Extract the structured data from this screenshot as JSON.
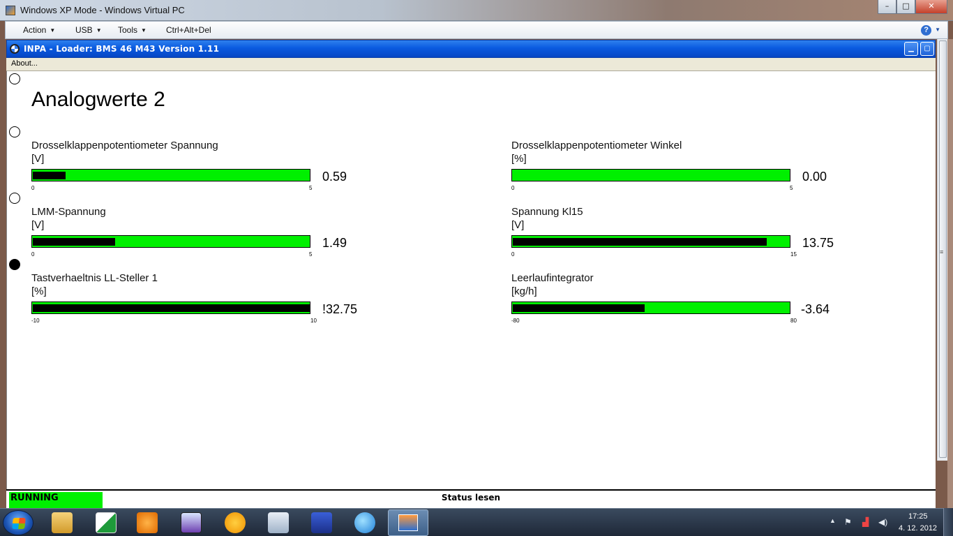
{
  "host_window": {
    "title": "Windows XP Mode - Windows Virtual PC",
    "minimize": "–",
    "maximize": "□",
    "close": "✕"
  },
  "host_menu": {
    "action": "Action",
    "usb": "USB",
    "tools": "Tools",
    "ctrl_alt_del": "Ctrl+Alt+Del",
    "help": "?"
  },
  "guest_window": {
    "title": "INPA - Loader:  BMS 46 M43 Version 1.11",
    "menu_about": "About..."
  },
  "page": {
    "heading": "Analogwerte 2"
  },
  "gauges": [
    {
      "label": "Drosselklappenpotentiometer Spannung",
      "unit": "[V]",
      "min": "0",
      "max": "5",
      "value_text": "0.59",
      "fill_fraction": 0.118
    },
    {
      "label": "Drosselklappenpotentiometer Winkel",
      "unit": "[%]",
      "min": "0",
      "max": "5",
      "value_text": "0.00",
      "fill_fraction": 0.0
    },
    {
      "label": "LMM-Spannung",
      "unit": "[V]",
      "min": "0",
      "max": "5",
      "value_text": "1.49",
      "fill_fraction": 0.298
    },
    {
      "label": "Spannung Kl15",
      "unit": "[V]",
      "min": "0",
      "max": "15",
      "value_text": "13.75",
      "fill_fraction": 0.917
    },
    {
      "label": "Tastverhaeltnis LL-Steller 1",
      "unit": "[%]",
      "min": "-10",
      "max": "10",
      "value_text": "!32.75",
      "fill_fraction": 1.0
    },
    {
      "label": "Leerlaufintegrator",
      "unit": "[kg/h]",
      "min": "-80",
      "max": "80",
      "value_text": "-3.64",
      "fill_fraction": 0.477
    }
  ],
  "status_bar": {
    "state": "RUNNING",
    "message": "Status lesen",
    "state_color": "#00f000"
  },
  "taskbar": {
    "time": "17:25",
    "date": "4. 12. 2012"
  }
}
